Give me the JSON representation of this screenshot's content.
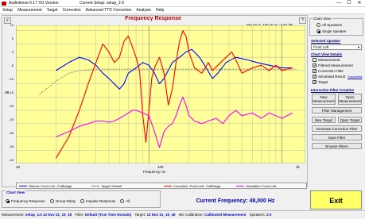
{
  "window": {
    "app_title": "Audiolense 6.17 XO Version",
    "setup_title": "Current Setup: setup_2.0",
    "controls": {
      "minimize": "—",
      "maximize": "☐",
      "close": "✕"
    }
  },
  "menu": [
    "Setup",
    "Measurement",
    "Target",
    "Correction",
    "Advanced TTD Correction",
    "Analysis",
    "Help"
  ],
  "plot": {
    "title": "Frequency Response",
    "mouse_info": "Mouse X: 187 Hz  Y: -4.52 dB",
    "corner_buttons": {
      "left": "≡",
      "right": "?"
    },
    "y_axis_label": "dB",
    "x_axis_label": "Frequency Hz",
    "y_ticks": [
      "10",
      "5",
      "0",
      "-5",
      "-10",
      "-15",
      "-20",
      "-25",
      "-30",
      "-35",
      "-40"
    ],
    "x_ticks": [
      "10",
      "100",
      "1k"
    ]
  },
  "chart_data": {
    "type": "line",
    "title": "Frequency Response",
    "xlabel": "Frequency Hz",
    "ylabel": "dB",
    "x_scale": "log",
    "xlim": [
      10,
      1500
    ],
    "ylim": [
      -40,
      12
    ],
    "grid": true,
    "series": [
      {
        "name": "Filtered: Front Left - FullRange",
        "color": "#0000ff",
        "points": [
          [
            20,
            -5
          ],
          [
            25,
            -2
          ],
          [
            30,
            0
          ],
          [
            35,
            -1
          ],
          [
            40,
            -3
          ],
          [
            45,
            -6
          ],
          [
            50,
            -8
          ],
          [
            55,
            -10
          ],
          [
            60,
            -12
          ],
          [
            65,
            -10
          ],
          [
            70,
            -6
          ],
          [
            80,
            -4
          ],
          [
            90,
            -2
          ],
          [
            100,
            -3
          ],
          [
            110,
            -6
          ],
          [
            120,
            -10
          ],
          [
            130,
            -8
          ],
          [
            150,
            -2
          ],
          [
            170,
            0
          ],
          [
            190,
            2
          ],
          [
            210,
            3
          ],
          [
            240,
            0
          ],
          [
            270,
            -4
          ],
          [
            300,
            -8
          ],
          [
            330,
            -6
          ],
          [
            380,
            -2
          ],
          [
            450,
            0
          ],
          [
            550,
            -1
          ],
          [
            650,
            -2
          ],
          [
            800,
            -3
          ],
          [
            1000,
            -4
          ],
          [
            1200,
            -4
          ]
        ]
      },
      {
        "name": "Target: Default",
        "color": "#707070",
        "points": [
          [
            15,
            -14
          ],
          [
            20,
            -9
          ],
          [
            25,
            -6
          ],
          [
            30,
            -5
          ],
          [
            40,
            -4.5
          ],
          [
            80,
            -4.5
          ],
          [
            200,
            -4.5
          ],
          [
            500,
            -4.5
          ],
          [
            1000,
            -4.5
          ],
          [
            1300,
            -4.5
          ]
        ]
      },
      {
        "name": "Correction: Front Left - FullRange",
        "color": "#ff0000",
        "points": [
          [
            20,
            -38
          ],
          [
            25,
            -30
          ],
          [
            30,
            -20
          ],
          [
            35,
            -10
          ],
          [
            40,
            -2
          ],
          [
            45,
            5
          ],
          [
            50,
            2
          ],
          [
            55,
            -2
          ],
          [
            60,
            0
          ],
          [
            65,
            6
          ],
          [
            70,
            8
          ],
          [
            75,
            4
          ],
          [
            80,
            0
          ],
          [
            85,
            -5
          ],
          [
            90,
            -22
          ],
          [
            95,
            -32
          ],
          [
            100,
            -20
          ],
          [
            105,
            -8
          ],
          [
            110,
            -4
          ],
          [
            120,
            0
          ],
          [
            130,
            -6
          ],
          [
            140,
            -18
          ],
          [
            150,
            -12
          ],
          [
            160,
            -2
          ],
          [
            170,
            6
          ],
          [
            180,
            10
          ],
          [
            190,
            8
          ],
          [
            200,
            2
          ],
          [
            220,
            -4
          ],
          [
            250,
            -6
          ],
          [
            280,
            -2
          ],
          [
            300,
            -5
          ],
          [
            330,
            -3
          ],
          [
            380,
            0
          ],
          [
            420,
            2
          ],
          [
            460,
            -2
          ],
          [
            500,
            -6
          ],
          [
            600,
            -4
          ],
          [
            700,
            -3
          ],
          [
            800,
            -5
          ],
          [
            900,
            -3
          ],
          [
            1000,
            -5
          ],
          [
            1200,
            -4
          ]
        ]
      },
      {
        "name": "Simulation: Front Left",
        "color": "#ff00ff",
        "points": [
          [
            20,
            -30
          ],
          [
            25,
            -28
          ],
          [
            30,
            -26
          ],
          [
            35,
            -25
          ],
          [
            40,
            -24
          ],
          [
            45,
            -24
          ],
          [
            50,
            -24.5
          ],
          [
            55,
            -24
          ],
          [
            60,
            -23
          ],
          [
            65,
            -22
          ],
          [
            70,
            -21
          ],
          [
            75,
            -20
          ],
          [
            80,
            -20
          ],
          [
            90,
            -21
          ],
          [
            100,
            -22
          ],
          [
            110,
            -28
          ],
          [
            120,
            -34
          ],
          [
            130,
            -28
          ],
          [
            140,
            -26
          ],
          [
            150,
            -25
          ],
          [
            160,
            -22
          ],
          [
            170,
            -18
          ],
          [
            180,
            -15
          ],
          [
            190,
            -18
          ],
          [
            200,
            -22
          ],
          [
            220,
            -24
          ],
          [
            250,
            -25
          ],
          [
            280,
            -24
          ],
          [
            320,
            -23
          ],
          [
            360,
            -25
          ],
          [
            400,
            -22
          ],
          [
            450,
            -20
          ],
          [
            500,
            -22
          ],
          [
            600,
            -21
          ],
          [
            700,
            -23
          ],
          [
            800,
            -21
          ],
          [
            900,
            -22
          ],
          [
            1000,
            -23
          ],
          [
            1200,
            -21
          ]
        ]
      }
    ]
  },
  "legend": [
    {
      "label": "Filtered: Front Left - FullRange",
      "color": "#0000ff",
      "dashed": false
    },
    {
      "label": "Target: Default",
      "color": "#707070",
      "dashed": true
    },
    {
      "label": "Correction: Front Left - FullRange",
      "color": "#ff0000",
      "dashed": false
    },
    {
      "label": "Simulation: Front Left",
      "color": "#ff00ff",
      "dashed": false
    }
  ],
  "chart_view_bottom": {
    "caption": "Chart View",
    "options": [
      {
        "label": "Frequency Response",
        "selected": true
      },
      {
        "label": "Group Delay",
        "selected": false
      },
      {
        "label": "Impulse Response",
        "selected": false
      },
      {
        "label": "All",
        "selected": false
      }
    ]
  },
  "current_frequency": "Current Frequency: 48,000 Hz",
  "exit_label": "Exit",
  "status": [
    {
      "key": "Measurement:",
      "value": "setup_2.0 12 Nov 21_16_28"
    },
    {
      "key": "Filter:",
      "value": "Default (True Time Domain)"
    },
    {
      "key": "Target:",
      "value": "13 Nov 21_16_49"
    },
    {
      "key": "Mic Calibration:",
      "value": "Calibrated Measurement"
    },
    {
      "key": "Speakers:",
      "value": "2.0"
    }
  ],
  "right_panel": {
    "chart_view": {
      "caption": "Chart View",
      "options": [
        {
          "label": "All Speakers",
          "selected": false
        },
        {
          "label": "Single Speaker",
          "selected": true
        }
      ]
    },
    "selected_speaker": {
      "caption": "Selected Speaker",
      "value": "Front Left"
    },
    "chart_view_details": {
      "caption": "Chart View Details",
      "items": [
        {
          "label": "Measurement",
          "checked": false
        },
        {
          "label": "Filtered Measurement",
          "checked": true
        },
        {
          "label": "Correction Filter",
          "checked": true
        },
        {
          "label": "Simulated Result",
          "checked": true
        },
        {
          "label": "Target",
          "checked": true
        }
      ],
      "smoothed_link": "Smoothed"
    },
    "interactive": {
      "caption": "Interactive Filter Creation",
      "new_measurement": "New Measurement",
      "open_measurement": "Open Measurement",
      "filter_management": "Filter Management",
      "new_target": "New Target",
      "open_target": "Open Target",
      "generate_filter": "Generate Correction Filter",
      "save_filter": "Save Filter",
      "browse_filters": "Browse Filters"
    }
  }
}
